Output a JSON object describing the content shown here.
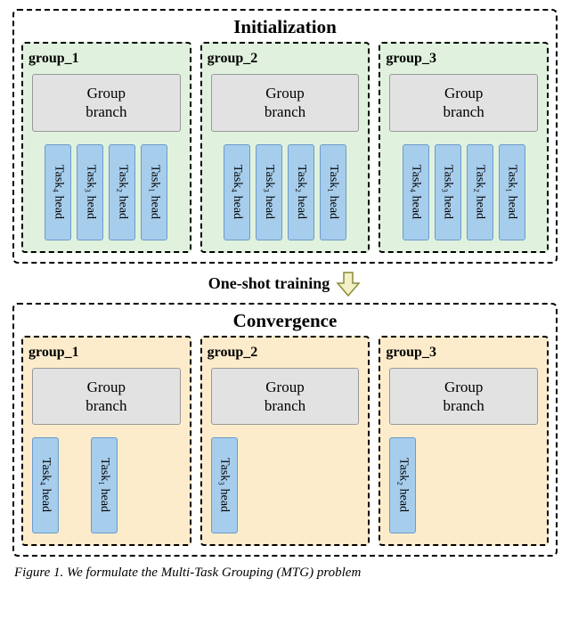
{
  "phases": {
    "init": {
      "title": "Initialization",
      "groups": [
        {
          "label": "group_1",
          "branch": "Group\nbranch",
          "heads": [
            {
              "task": 4,
              "text": "Task₄ head"
            },
            {
              "task": 3,
              "text": "Task₃ head"
            },
            {
              "task": 2,
              "text": "Task₂ head"
            },
            {
              "task": 1,
              "text": "Task₁ head"
            }
          ]
        },
        {
          "label": "group_2",
          "branch": "Group\nbranch",
          "heads": [
            {
              "task": 4,
              "text": "Task₄ head"
            },
            {
              "task": 3,
              "text": "Task₃ head"
            },
            {
              "task": 2,
              "text": "Task₂ head"
            },
            {
              "task": 1,
              "text": "Task₁ head"
            }
          ]
        },
        {
          "label": "group_3",
          "branch": "Group\nbranch",
          "heads": [
            {
              "task": 4,
              "text": "Task₄ head"
            },
            {
              "task": 3,
              "text": "Task₃ head"
            },
            {
              "task": 2,
              "text": "Task₂ head"
            },
            {
              "task": 1,
              "text": "Task₁ head"
            }
          ]
        }
      ]
    },
    "transition_label": "One-shot training",
    "conv": {
      "title": "Convergence",
      "groups": [
        {
          "label": "group_1",
          "branch": "Group\nbranch",
          "heads": [
            {
              "task": 4,
              "text": "Task₄ head"
            },
            {
              "task": 1,
              "text": "Task₁ head"
            }
          ]
        },
        {
          "label": "group_2",
          "branch": "Group\nbranch",
          "heads": [
            {
              "task": 3,
              "text": "Task₃ head"
            }
          ]
        },
        {
          "label": "group_3",
          "branch": "Group\nbranch",
          "heads": [
            {
              "task": 2,
              "text": "Task₂ head"
            }
          ]
        }
      ]
    }
  },
  "caption_prefix": "Figure 1.",
  "caption_body": " We formulate the Multi-Task Grouping (MTG) problem",
  "chart_data": {
    "type": "diagram",
    "description": "Multi-Task Grouping: initialization vs convergence after one-shot training",
    "num_groups": 3,
    "num_tasks": 4,
    "initialization": {
      "group_1": [
        "Task4",
        "Task3",
        "Task2",
        "Task1"
      ],
      "group_2": [
        "Task4",
        "Task3",
        "Task2",
        "Task1"
      ],
      "group_3": [
        "Task4",
        "Task3",
        "Task2",
        "Task1"
      ]
    },
    "convergence": {
      "group_1": [
        "Task4",
        "Task1"
      ],
      "group_2": [
        "Task3"
      ],
      "group_3": [
        "Task2"
      ]
    },
    "transition": "One-shot training",
    "colors": {
      "init_bg": "#e0f2de",
      "conv_bg": "#fdeccc",
      "branch": "#e2e2e2",
      "task_head": "#a7cdec"
    }
  }
}
